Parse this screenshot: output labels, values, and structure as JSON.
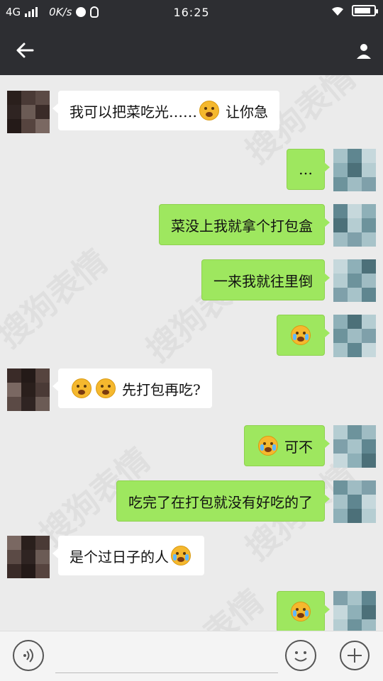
{
  "status_bar": {
    "network": "4G",
    "speed": "0K/s",
    "time": "16:25"
  },
  "header": {
    "title": ""
  },
  "messages": [
    {
      "side": "left",
      "parts": [
        "我可以把菜吃光……",
        "😲",
        "让你急"
      ]
    },
    {
      "side": "right",
      "parts": [
        "…"
      ]
    },
    {
      "side": "right",
      "parts": [
        "菜没上我就拿个打包盒"
      ]
    },
    {
      "side": "right",
      "parts": [
        "一来我就往里倒"
      ]
    },
    {
      "side": "right",
      "parts": [
        "😭"
      ]
    },
    {
      "side": "left",
      "parts": [
        "😲",
        "😲",
        "先打包再吃?"
      ]
    },
    {
      "side": "right",
      "parts": [
        "😭",
        "可不"
      ]
    },
    {
      "side": "right",
      "parts": [
        "吃完了在打包就没有好吃的了"
      ]
    },
    {
      "side": "left",
      "parts": [
        "是个过日子的人",
        "😭"
      ]
    },
    {
      "side": "right",
      "parts": [
        "😭"
      ]
    }
  ],
  "watermark": "搜狗表情",
  "icons": {
    "back": "back-arrow-icon",
    "voice": "voice-icon",
    "emoji": "emoji-icon",
    "more": "plus-icon"
  },
  "colors": {
    "header_bg": "#2d2e32",
    "chat_bg": "#ebebeb",
    "outgoing_bubble": "#9ee75f",
    "incoming_bubble": "#ffffff"
  }
}
